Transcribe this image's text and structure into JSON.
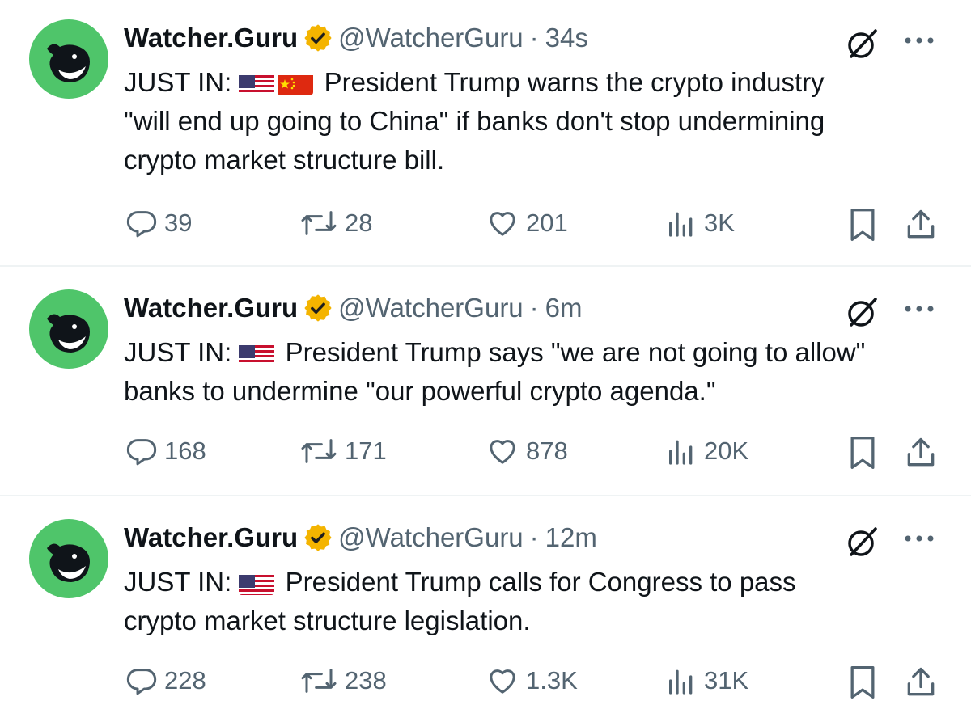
{
  "tweets": [
    {
      "author": "Watcher.Guru",
      "handle": "@WatcherGuru",
      "separator": "·",
      "time": "34s",
      "prefix": "JUST IN:",
      "flags": [
        "us-flag-icon",
        "china-flag-icon"
      ],
      "text_lines": [
        "President Trump warns the crypto industry",
        "\"will end up going to China\" if banks don't stop undermining",
        "crypto market structure bill."
      ],
      "replies": "39",
      "reposts": "28",
      "likes": "201",
      "views": "3K"
    },
    {
      "author": "Watcher.Guru",
      "handle": "@WatcherGuru",
      "separator": "·",
      "time": "6m",
      "prefix": "JUST IN:",
      "flags": [
        "us-flag-icon"
      ],
      "text_lines": [
        "President Trump says \"we are not going to allow\"",
        "banks to undermine \"our powerful crypto agenda.\""
      ],
      "replies": "168",
      "reposts": "171",
      "likes": "878",
      "views": "20K"
    },
    {
      "author": "Watcher.Guru",
      "handle": "@WatcherGuru",
      "separator": "·",
      "time": "12m",
      "prefix": "JUST IN:",
      "flags": [
        "us-flag-icon"
      ],
      "text_lines": [
        "President Trump calls for Congress to pass",
        "crypto market structure legislation."
      ],
      "replies": "228",
      "reposts": "238",
      "likes": "1.3K",
      "views": "31K"
    }
  ],
  "colors": {
    "text": "#0f1419",
    "secondary": "#536471",
    "avatar_bg": "#4fc56a",
    "verified_badge": "#f4b400",
    "divider": "#eff3f4"
  }
}
